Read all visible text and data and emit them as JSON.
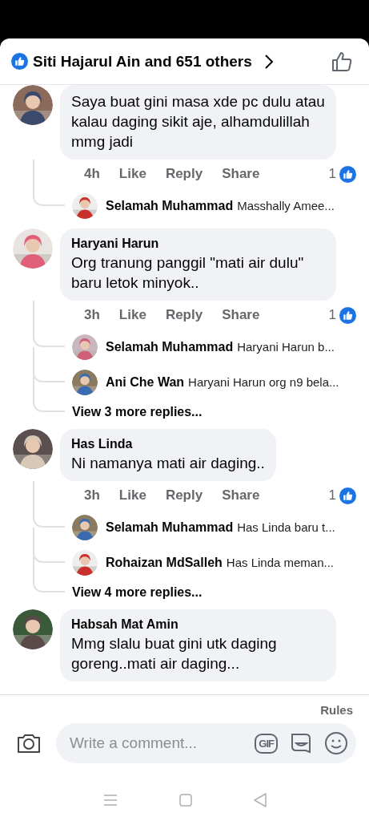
{
  "header": {
    "reactions_label": "Siti Hajarul Ain and 651 others"
  },
  "comments": [
    {
      "text": "Saya buat gini masa xde pc dulu atau kalau daging sikit aje, alhamdulillah mmg jadi",
      "time": "4h",
      "actions": [
        "Like",
        "Reply",
        "Share"
      ],
      "like_count": "1",
      "replies": [
        {
          "name": "Selamah Muhammad",
          "text": "Masshally Amee..."
        }
      ]
    },
    {
      "name": "Haryani Harun",
      "text": "Org tranung panggil \"mati air dulu\" baru letok minyok..",
      "time": "3h",
      "actions": [
        "Like",
        "Reply",
        "Share"
      ],
      "like_count": "1",
      "replies": [
        {
          "name": "Selamah Muhammad",
          "text": "Haryani Harun b..."
        },
        {
          "name": "Ani Che Wan",
          "text": "Haryani Harun org n9 bela..."
        }
      ],
      "more_replies": "View 3 more replies..."
    },
    {
      "name": "Has Linda",
      "text": "Ni namanya mati air daging..",
      "time": "3h",
      "actions": [
        "Like",
        "Reply",
        "Share"
      ],
      "like_count": "1",
      "replies": [
        {
          "name": "Selamah Muhammad",
          "text": "Has Linda baru t..."
        },
        {
          "name": "Rohaizan MdSalleh",
          "text": "Has Linda meman..."
        }
      ],
      "more_replies": "View 4 more replies..."
    },
    {
      "name": "Habsah Mat Amin",
      "text": "Mmg slalu buat gini utk daging goreng..mati air daging..."
    }
  ],
  "composer": {
    "rules": "Rules",
    "placeholder": "Write a comment...",
    "gif": "GIF"
  }
}
